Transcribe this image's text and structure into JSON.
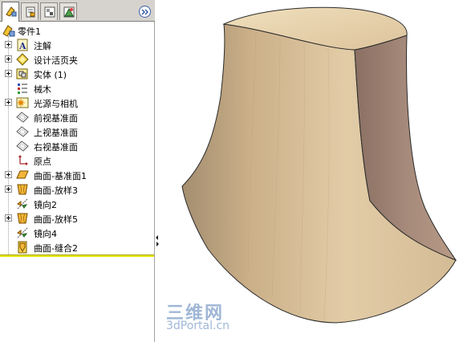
{
  "tabs": [
    {
      "name": "featuremanager-icon",
      "active": true
    },
    {
      "name": "propertymanager-icon",
      "active": false
    },
    {
      "name": "configurationmanager-icon",
      "active": false
    },
    {
      "name": "dimxpert-icon",
      "active": false
    }
  ],
  "tree": {
    "root": "零件1",
    "items": [
      {
        "label": "注解",
        "icon": "annotations-icon",
        "expandable": true
      },
      {
        "label": "设计活页夹",
        "icon": "design-binder-icon",
        "expandable": true
      },
      {
        "label": "实体 (1)",
        "icon": "solid-bodies-icon",
        "expandable": true
      },
      {
        "label": "械木",
        "icon": "material-icon",
        "expandable": false
      },
      {
        "label": "光源与相机",
        "icon": "lights-cameras-icon",
        "expandable": true
      },
      {
        "label": "前视基准面",
        "icon": "plane-icon",
        "expandable": false
      },
      {
        "label": "上视基准面",
        "icon": "plane-icon",
        "expandable": false
      },
      {
        "label": "右视基准面",
        "icon": "plane-icon",
        "expandable": false
      },
      {
        "label": "原点",
        "icon": "origin-icon",
        "expandable": false
      },
      {
        "label": "曲面-基准面1",
        "icon": "planar-surface-icon",
        "expandable": true
      },
      {
        "label": "曲面-放样3",
        "icon": "loft-surface-icon",
        "expandable": true
      },
      {
        "label": "镜向2",
        "icon": "mirror-icon",
        "expandable": false
      },
      {
        "label": "曲面-放样5",
        "icon": "loft-surface-icon",
        "expandable": true
      },
      {
        "label": "镜向4",
        "icon": "mirror-icon",
        "expandable": false
      },
      {
        "label": "曲面-缝合2",
        "icon": "knit-surface-icon",
        "expandable": false
      }
    ]
  },
  "watermark": {
    "logo": "三维网",
    "url": "3dPortal.cn"
  },
  "colors": {
    "rollback_bar": "#e6e600",
    "wood_light": "#e6d3b0",
    "wood_mid": "#cbb089",
    "wood_dark": "#8d7867"
  }
}
